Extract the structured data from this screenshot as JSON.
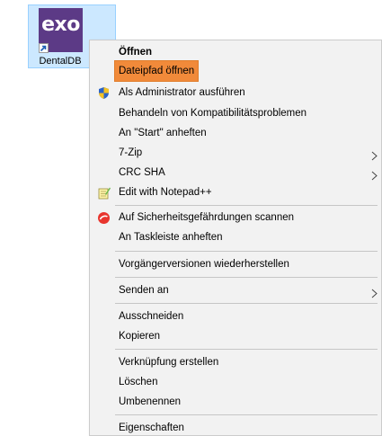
{
  "desktop": {
    "shortcut": {
      "icon_text": "exo",
      "label": "DentalDB",
      "app_color": "#5c3a86",
      "selection_color": "#cce8ff"
    }
  },
  "context_menu": {
    "highlight_color": "#f18a3a",
    "items": [
      {
        "label": "Öffnen",
        "bold": true
      },
      {
        "label": "Dateipfad öffnen",
        "highlighted": true
      },
      {
        "label": "Als Administrator ausführen",
        "icon": "shield-icon"
      },
      {
        "label": "Behandeln von Kompatibilitätsproblemen"
      },
      {
        "label": "An \"Start\" anheften"
      },
      {
        "label": "7-Zip",
        "submenu": true
      },
      {
        "label": "CRC SHA",
        "submenu": true
      },
      {
        "label": "Edit with Notepad++",
        "icon": "notepad-icon"
      },
      {
        "label": "Auf Sicherheitsgefährdungen scannen",
        "icon": "scan-icon"
      },
      {
        "label": "An Taskleiste anheften"
      },
      {
        "label": "Vorgängerversionen wiederherstellen"
      },
      {
        "label": "Senden an",
        "submenu": true
      },
      {
        "label": "Ausschneiden"
      },
      {
        "label": "Kopieren"
      },
      {
        "label": "Verknüpfung erstellen"
      },
      {
        "label": "Löschen"
      },
      {
        "label": "Umbenennen"
      },
      {
        "label": "Eigenschaften"
      }
    ]
  }
}
